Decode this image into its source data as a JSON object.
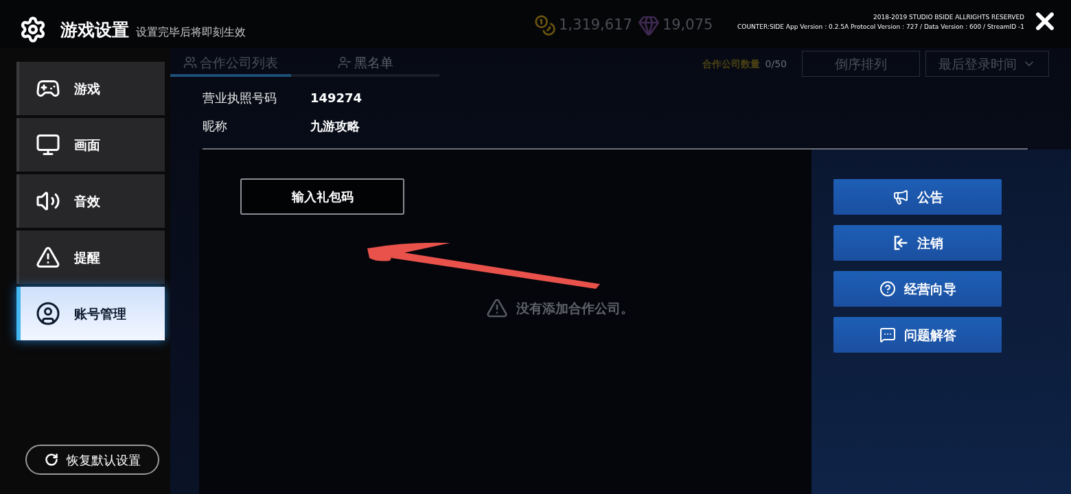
{
  "header": {
    "title": "游戏设置",
    "subtitle": "设置完毕后将即刻生效"
  },
  "currencies": [
    {
      "kind": "coin",
      "amount": "1,319,617"
    },
    {
      "kind": "gem",
      "amount": "19,075"
    }
  ],
  "copyright": "2018-2019 STUDIO BSIDE ALLRIGHTS RESERVED",
  "version_info": "COUNTER:SIDE App Version : 0.2.5A Protocol Version : 727 / Data Version : 600 / StreamID -1",
  "sidebar": {
    "items": [
      {
        "kind": "gamepad",
        "label": "游戏",
        "selected": false
      },
      {
        "kind": "monitor",
        "label": "画面",
        "selected": false
      },
      {
        "kind": "speaker",
        "label": "音效",
        "selected": false
      },
      {
        "kind": "warning",
        "label": "提醒",
        "selected": false
      },
      {
        "kind": "account",
        "label": "账号管理",
        "selected": true
      }
    ]
  },
  "reset_button": "恢复默认设置",
  "background_tabs": [
    {
      "kind": "list",
      "label": "合作公司列表",
      "selected": true
    },
    {
      "kind": "block",
      "label": "黑名单",
      "selected": false
    }
  ],
  "partner_count": {
    "label": "合作公司数量",
    "value": "0/50"
  },
  "sort_buttons": [
    {
      "kind": "plain",
      "label": "倒序排列"
    },
    {
      "kind": "dropdown",
      "label": "最后登录时间"
    }
  ],
  "account_info": [
    {
      "label": "营业执照号码",
      "value": "149274"
    },
    {
      "label": "昵称",
      "value": "九游攻略"
    }
  ],
  "gift_code_button": "输入礼包码",
  "empty_message": "没有添加合作公司。",
  "actions": [
    {
      "kind": "megaphone",
      "label": "公告"
    },
    {
      "kind": "logout",
      "label": "注销"
    },
    {
      "kind": "help",
      "label": "经营向导"
    },
    {
      "kind": "chat",
      "label": "问题解答"
    }
  ]
}
